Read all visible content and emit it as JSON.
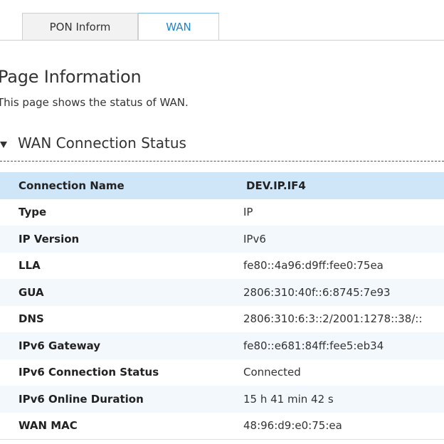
{
  "tabs": [
    {
      "label": "PON Inform",
      "active": false
    },
    {
      "label": "WAN",
      "active": true
    }
  ],
  "page": {
    "title": "Page Information",
    "description": "This page shows the status of WAN."
  },
  "section": {
    "title": "WAN Connection Status",
    "icon": "triangle-down-icon"
  },
  "table": {
    "header": {
      "label": "Connection Name",
      "value": "DEV.IP.IF4"
    },
    "rows": [
      {
        "label": "Type",
        "value": "IP"
      },
      {
        "label": "IP Version",
        "value": "IPv6"
      },
      {
        "label": "LLA",
        "value": "fe80::4a96:d9ff:fee0:75ea"
      },
      {
        "label": "GUA",
        "value": "2806:310:40f::6:8745:7e93"
      },
      {
        "label": "DNS",
        "value": "2806:310:6:3::2/2001:1278::38/::"
      },
      {
        "label": "IPv6 Gateway",
        "value": "fe80::e681:84ff:fee5:eb34"
      },
      {
        "label": "IPv6 Connection Status",
        "value": "Connected"
      },
      {
        "label": "IPv6 Online Duration",
        "value": "15 h 41 min 42 s"
      },
      {
        "label": "WAN MAC",
        "value": "48:96:d9:e0:75:ea"
      }
    ]
  },
  "colors": {
    "active_tab_text": "#1e86c5",
    "header_row_bg": "#cfe6f8",
    "alt_row_bg": "#f3f8fc"
  }
}
